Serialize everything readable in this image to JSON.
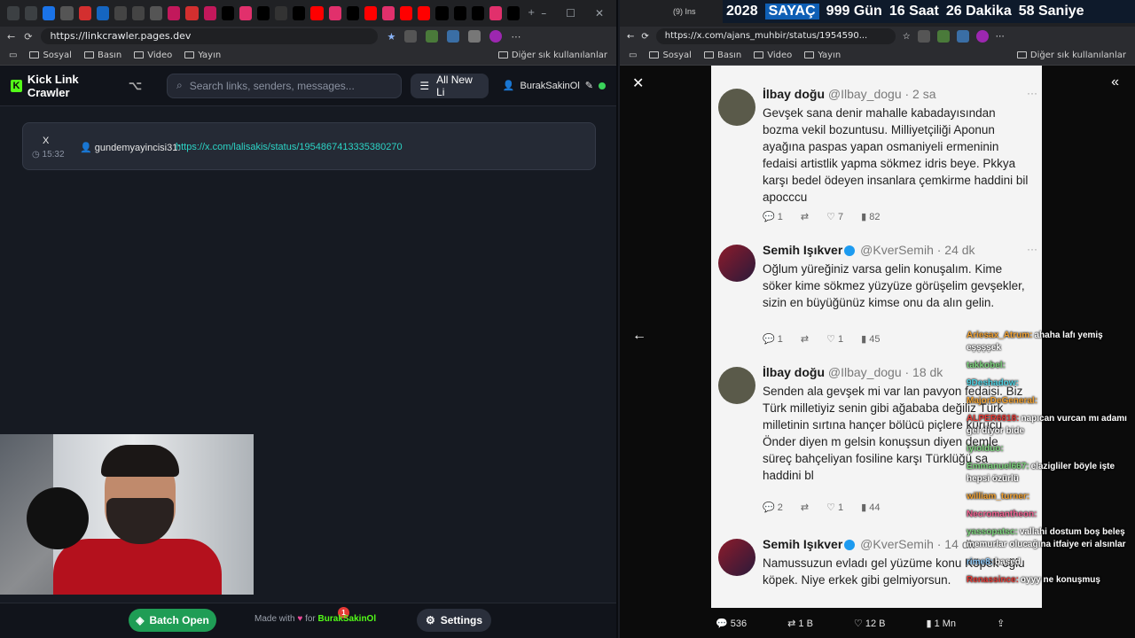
{
  "left": {
    "url": "https://linkcrawler.pages.dev",
    "bookmarks": [
      "Sosyal",
      "Basın",
      "Video",
      "Yayın"
    ],
    "other_bookmarks": "Diğer sık kullanılanlar",
    "app_title": "Kick Link Crawler",
    "search_placeholder": "Search links, senders, messages...",
    "filter_label": "All New Li",
    "username": "BurakSakinOl",
    "link": {
      "platform": "X",
      "time": "15:32",
      "sender": "gundemyayincisi31:",
      "url": "https://x.com/lalisakis/status/1954867413335380270"
    },
    "batch_label": "Batch Open",
    "batch_count": "1",
    "made_with": "Made with",
    "made_for": "for",
    "made_author": "BurakSakinOl",
    "settings_label": "Settings"
  },
  "counter": {
    "year": "2028",
    "label": "SAYAÇ",
    "days": "999",
    "days_lbl": "Gün",
    "hours": "16",
    "hours_lbl": "Saat",
    "mins": "26",
    "mins_lbl": "Dakika",
    "secs": "58",
    "secs_lbl": "Saniye"
  },
  "right": {
    "url": "https://x.com/ajans_muhbir/status/1954590...",
    "tab_title": "(9) Ins",
    "bookmarks": [
      "Sosyal",
      "Basın",
      "Video",
      "Yayın"
    ],
    "other_bookmarks": "Diğer sık kullanılanlar",
    "tweets": [
      {
        "name": "İlbay doğu",
        "handle": "@Ilbay_dogu · 2 sa",
        "text": "Gevşek sana denir mahalle kabadayısından bozma vekil bozuntusu. Milliyetçiliği Aponun ayağına paspas yapan osmaniyeli ermeninin fedaisi artistlik yapma sökmez idris beye. Pkkya karşı bedel ödeyen insanlara çemkirme haddini bil apocccu",
        "replies": "1",
        "likes": "7",
        "views": "82"
      },
      {
        "name": "Semih Işıkver",
        "handle": "@KverSemih · 24 dk",
        "text": "Oğlum yüreğiniz varsa gelin konuşalım. Kime söker kime sökmez yüzyüze görüşelim gevşekler, sizin en büyüğünüz kimse onu da alın gelin.",
        "replies": "1",
        "likes": "1",
        "views": "45"
      },
      {
        "name": "İlbay doğu",
        "handle": "@Ilbay_dogu · 18 dk",
        "text": "Senden ala gevşek mi var lan pavyon fedaisi. Biz Türk milletiyiz senin gibi ağababa değiliz Türk milletinin sırtına hançer bölücü piçlere kurucu Önder diyen m gelsin konuşsun diyen demle süreç bahçeliyan fosiline karşı Türklüğü sa haddini bl",
        "replies": "2",
        "likes": "1",
        "views": "44"
      },
      {
        "name": "Semih Işıkver",
        "handle": "@KverSemih · 14 dk",
        "text": "Namussuzun evladı gel yüzüme konu Köpek oğlu köpek. Niye erkek gibi gelmiyorsun.",
        "replies": "",
        "likes": "",
        "views": ""
      }
    ],
    "stats": {
      "replies": "536",
      "reposts": "1 B",
      "likes": "12 B",
      "views": "1 Mn"
    }
  },
  "chat": [
    {
      "user": "Ariesax_Atrum:",
      "color": "#f0a030",
      "msg": "ahaha lafı yemiş eşşşşek"
    },
    {
      "user": "takkobel:",
      "color": "#7cd37c",
      "msg": ""
    },
    {
      "user": "9Deshadow:",
      "color": "#4dd0e1",
      "msg": ""
    },
    {
      "user": "MajorDeGeneral:",
      "color": "#f0a030",
      "msg": ""
    },
    {
      "user": "ALPER6818:",
      "color": "#e53935",
      "msg": "napıcan vurcan mı adamı gel diyor bide"
    },
    {
      "user": "iyiolduo:",
      "color": "#7cd37c",
      "msg": ""
    },
    {
      "user": "Emmanuel667:",
      "color": "#7cd37c",
      "msg": "elazigliler böyle işte hepsi özürlü"
    },
    {
      "user": "william_turner:",
      "color": "#f0a030",
      "msg": ""
    },
    {
      "user": "Necromantheon:",
      "color": "#f06292",
      "msg": ""
    },
    {
      "user": "yassopatsc:",
      "color": "#7cd37c",
      "msg": "vallahi dostum boş beleş memurlar olucağına itfaiye eri alsınlar"
    },
    {
      "user": "rime8:",
      "color": "#90caf9",
      "msg": "based"
    },
    {
      "user": "Renassince:",
      "color": "#e53935",
      "msg": "oyyy ne konuşmuş"
    }
  ]
}
